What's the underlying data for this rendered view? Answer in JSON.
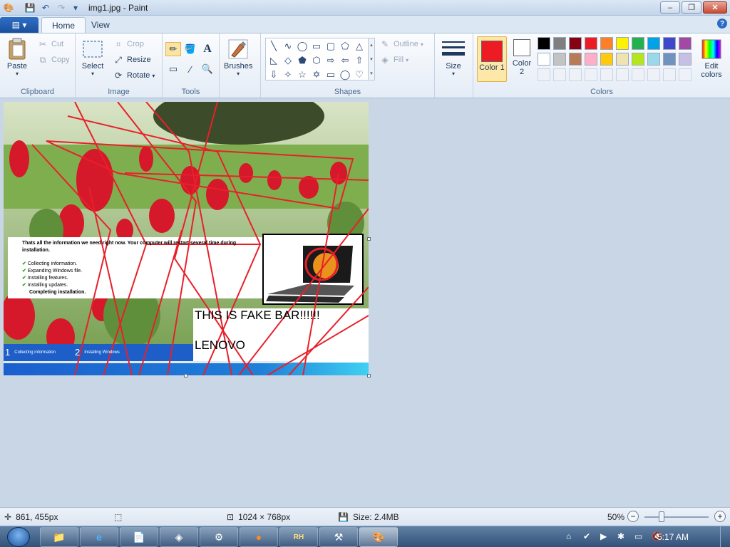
{
  "window": {
    "title": "img1.jpg - Paint"
  },
  "tabs": {
    "file_menu": "▤ ▾",
    "home": "Home",
    "view": "View"
  },
  "clipboard": {
    "paste": "Paste",
    "cut": "Cut",
    "copy": "Copy",
    "label": "Clipboard"
  },
  "image": {
    "select": "Select",
    "crop": "Crop",
    "resize": "Resize",
    "rotate": "Rotate",
    "label": "Image"
  },
  "tools": {
    "label": "Tools"
  },
  "brushes": {
    "label": "Brushes"
  },
  "shapes": {
    "outline": "Outline",
    "fill": "Fill",
    "label": "Shapes"
  },
  "size": {
    "label": "Size"
  },
  "colors": {
    "color1": "Color 1",
    "color2": "Color 2",
    "edit": "Edit colors",
    "label": "Colors",
    "color1_value": "#ed1c24",
    "color2_value": "#ffffff",
    "palette_row1": [
      "#000000",
      "#7f7f7f",
      "#880015",
      "#ed1c24",
      "#ff7f27",
      "#fff200",
      "#22b14c",
      "#00a2e8",
      "#3f48cc",
      "#a349a4"
    ],
    "palette_row2": [
      "#ffffff",
      "#c3c3c3",
      "#b97a57",
      "#ffaec9",
      "#ffc90e",
      "#efe4b0",
      "#b5e61d",
      "#99d9ea",
      "#7092be",
      "#c8bfe7"
    ]
  },
  "canvas": {
    "dialog_text": "Thats all the information we need right now. Your computer will restart several time during installation.",
    "steps": [
      "Collecting information.",
      "Expanding Windows file.",
      "Installing features.",
      "Installing updates."
    ],
    "step_current": "Completing installation.",
    "fake_bar": "THIS IS FAKE BAR!!!!!!",
    "lenovo": "LENOVO",
    "stage1_num": "1",
    "stage1_label": "Collecting information",
    "stage2_num": "2",
    "stage2_label": "Installing Windows"
  },
  "status": {
    "cursor": "861, 455px",
    "dimensions": "1024 × 768px",
    "size": "Size: 2.4MB",
    "zoom": "50%"
  },
  "taskbar": {
    "clock": "5:17 AM",
    "rh_label": "RH"
  }
}
